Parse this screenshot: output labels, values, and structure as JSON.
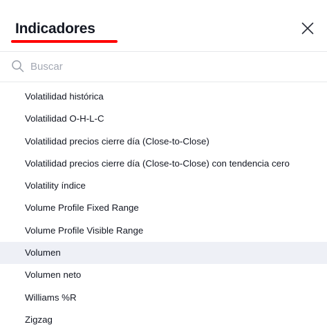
{
  "dialog": {
    "title": "Indicadores",
    "accent_color": "#ff0000",
    "close_icon": "close-icon"
  },
  "search": {
    "placeholder": "Buscar",
    "value": "",
    "icon": "search-icon"
  },
  "indicators": {
    "items": [
      {
        "label": "Volatilidad histórica"
      },
      {
        "label": "Volatilidad O-H-L-C"
      },
      {
        "label": "Volatilidad precios cierre día (Close-to-Close)"
      },
      {
        "label": "Volatilidad precios cierre día (Close-to-Close) con tendencia cero"
      },
      {
        "label": "Volatility índice"
      },
      {
        "label": "Volume Profile Fixed Range"
      },
      {
        "label": "Volume Profile Visible Range"
      },
      {
        "label": "Volumen"
      },
      {
        "label": "Volumen neto"
      },
      {
        "label": "Williams %R"
      },
      {
        "label": "Zigzag"
      }
    ],
    "highlighted": "Volumen"
  }
}
